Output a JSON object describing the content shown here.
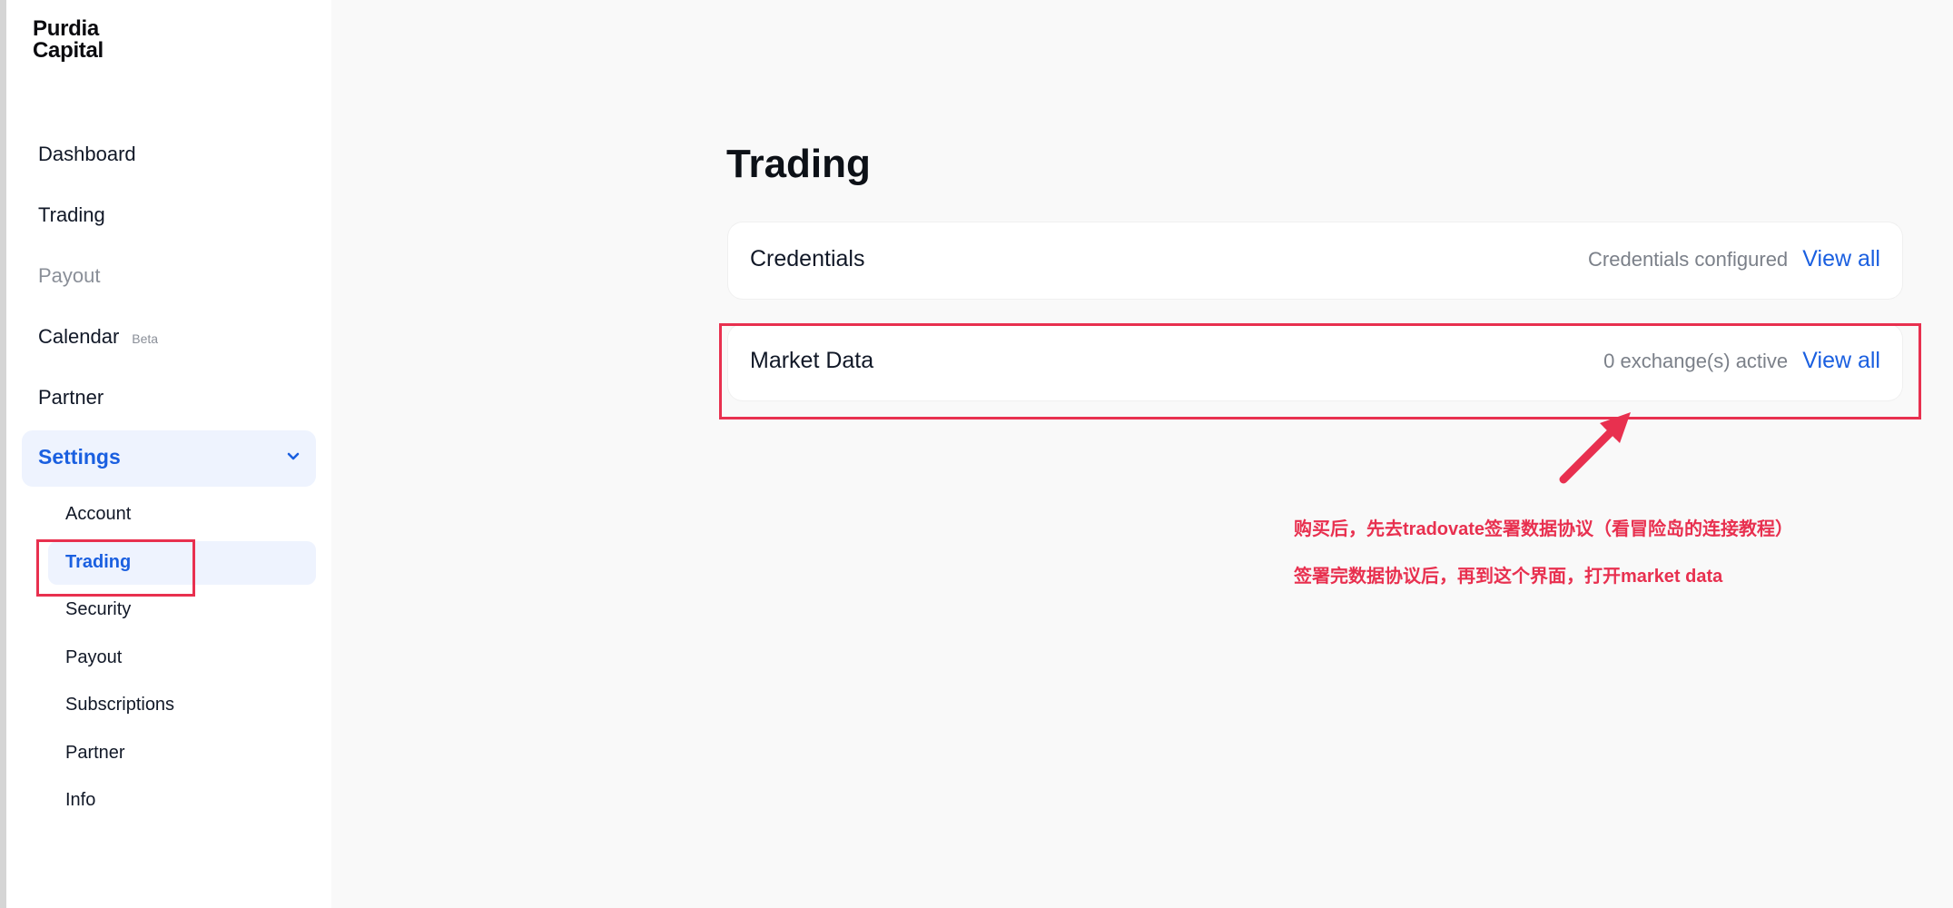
{
  "logo": {
    "line1": "Purdia",
    "line2": "Capital"
  },
  "nav": [
    {
      "label": "Dashboard"
    },
    {
      "label": "Trading"
    },
    {
      "label": "Payout"
    },
    {
      "label": "Calendar",
      "badge": "Beta"
    },
    {
      "label": "Partner"
    }
  ],
  "settings": {
    "label": "Settings",
    "chevron": "chevron-down-icon",
    "items": [
      {
        "label": "Account"
      },
      {
        "label": "Trading",
        "active": true
      },
      {
        "label": "Security"
      },
      {
        "label": "Payout"
      },
      {
        "label": "Subscriptions"
      },
      {
        "label": "Partner"
      },
      {
        "label": "Info"
      }
    ]
  },
  "main": {
    "title": "Trading",
    "cards": [
      {
        "title": "Credentials",
        "status": "Credentials configured",
        "link": "View all"
      },
      {
        "title": "Market Data",
        "status": "0 exchange(s) active",
        "link": "View all"
      }
    ]
  },
  "annotation": {
    "line1": "购买后，先去tradovate签署数据协议（看冒险岛的连接教程）",
    "line2": "签署完数据协议后，再到这个界面，打开market data",
    "color": "#e8304f"
  },
  "colors": {
    "accent": "#1a5fe0",
    "annotation": "#e8304f",
    "sidebar_active_bg": "#eef3fe"
  }
}
